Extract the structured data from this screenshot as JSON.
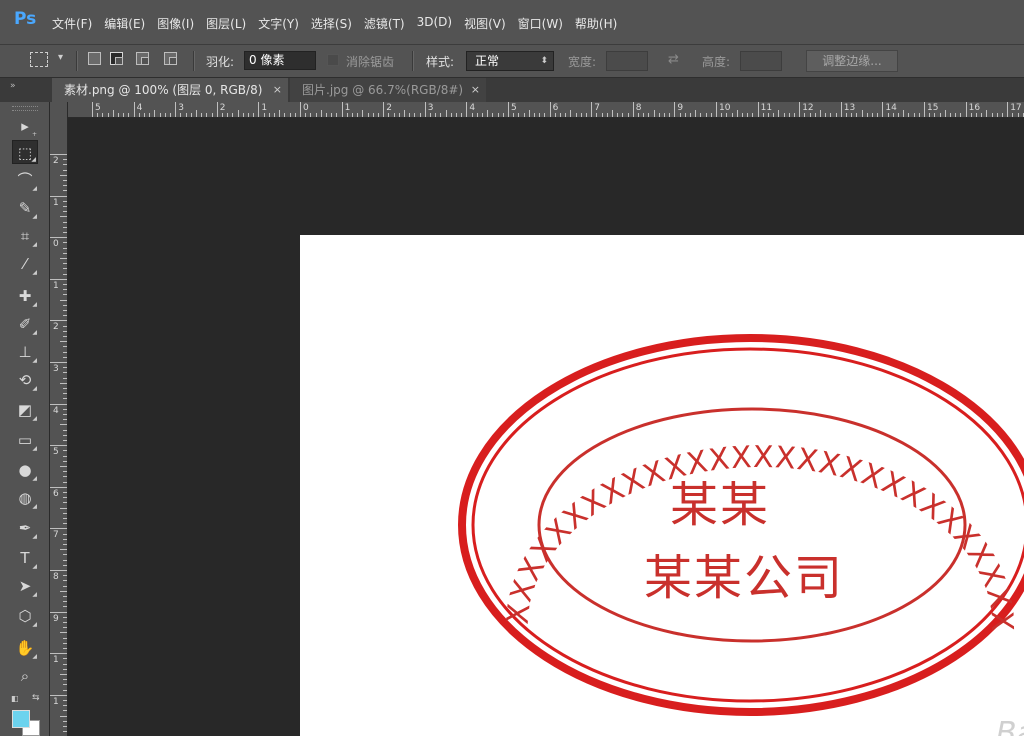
{
  "app": {
    "logo": "Ps"
  },
  "menu": [
    "文件(F)",
    "编辑(E)",
    "图像(I)",
    "图层(L)",
    "文字(Y)",
    "选择(S)",
    "滤镜(T)",
    "3D(D)",
    "视图(V)",
    "窗口(W)",
    "帮助(H)"
  ],
  "options": {
    "feather_label": "羽化:",
    "feather_value": "0 像素",
    "antialias_label": "消除锯齿",
    "style_label": "样式:",
    "style_value": "正常",
    "width_label": "宽度:",
    "height_label": "高度:",
    "refine_edge_label": "调整边缘..."
  },
  "panel_toggle": "»",
  "tabs": [
    {
      "label": "素材.png @ 100% (图层 0, RGB/8)",
      "close": "×"
    },
    {
      "label": "图片.jpg @ 66.7%(RGB/8#)",
      "close": "×"
    }
  ],
  "ruler_top_labels": [
    "5",
    "4",
    "3",
    "2",
    "1",
    "0",
    "1",
    "2",
    "3",
    "4",
    "5",
    "6",
    "7",
    "8",
    "9",
    "10",
    "11",
    "12",
    "13",
    "14",
    "15",
    "16",
    "17"
  ],
  "ruler_left_labels": [
    "2",
    "1",
    "0",
    "1",
    "2",
    "3",
    "4",
    "5",
    "6",
    "7",
    "8",
    "9",
    "1",
    "1"
  ],
  "stamp": {
    "arc_text": "XXXXXXXXXXXXXXXXXXXXXXXXXXXXX",
    "line1": "某某",
    "line2": "某某公司",
    "color": "#c9302c"
  },
  "colors": {
    "foreground": "#6cd3ee",
    "background": "#ffffff"
  },
  "icons": [
    "move-icon",
    "marquee-icon",
    "lasso-icon",
    "quick-select-icon",
    "crop-icon",
    "eyedropper-icon",
    "healing-icon",
    "brush-icon",
    "stamp-icon",
    "history-brush-icon",
    "eraser-icon",
    "gradient-icon",
    "blur-icon",
    "dodge-icon",
    "pen-icon",
    "type-icon",
    "path-select-icon",
    "shape-icon",
    "hand-icon",
    "zoom-icon"
  ]
}
